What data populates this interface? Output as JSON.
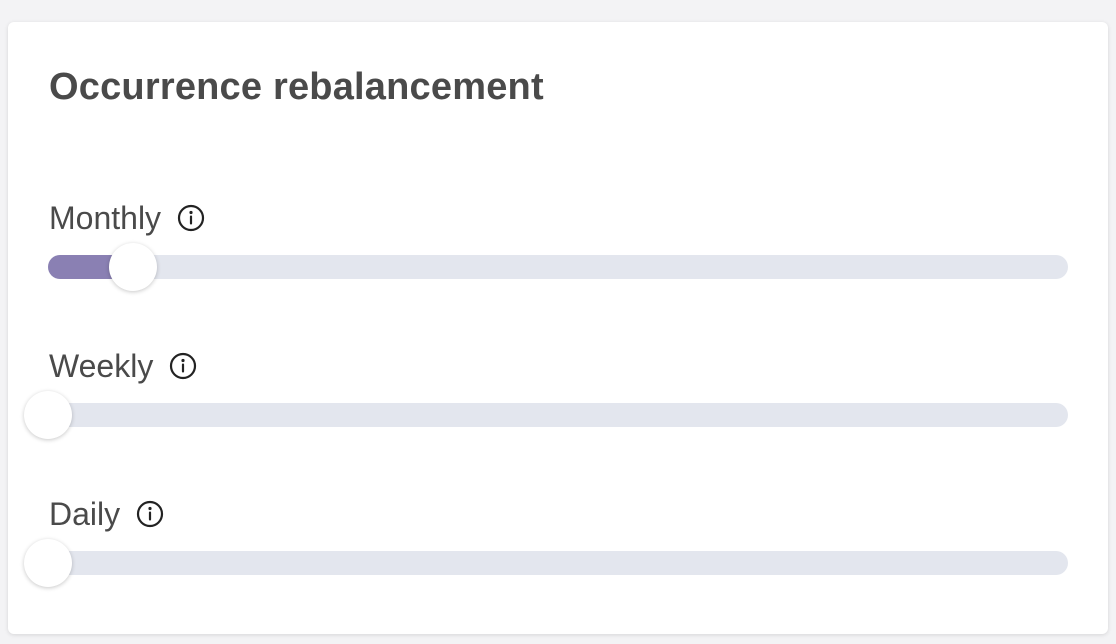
{
  "card": {
    "title": "Occurrence rebalancement"
  },
  "colors": {
    "accent": "#8a80b3",
    "track": "#e3e6ee",
    "text": "#4a4a4a"
  },
  "sliders": [
    {
      "label": "Monthly",
      "icon": "info-icon",
      "value_fraction": 0.083
    },
    {
      "label": "Weekly",
      "icon": "info-icon",
      "value_fraction": 0.0
    },
    {
      "label": "Daily",
      "icon": "info-icon",
      "value_fraction": 0.0
    }
  ]
}
